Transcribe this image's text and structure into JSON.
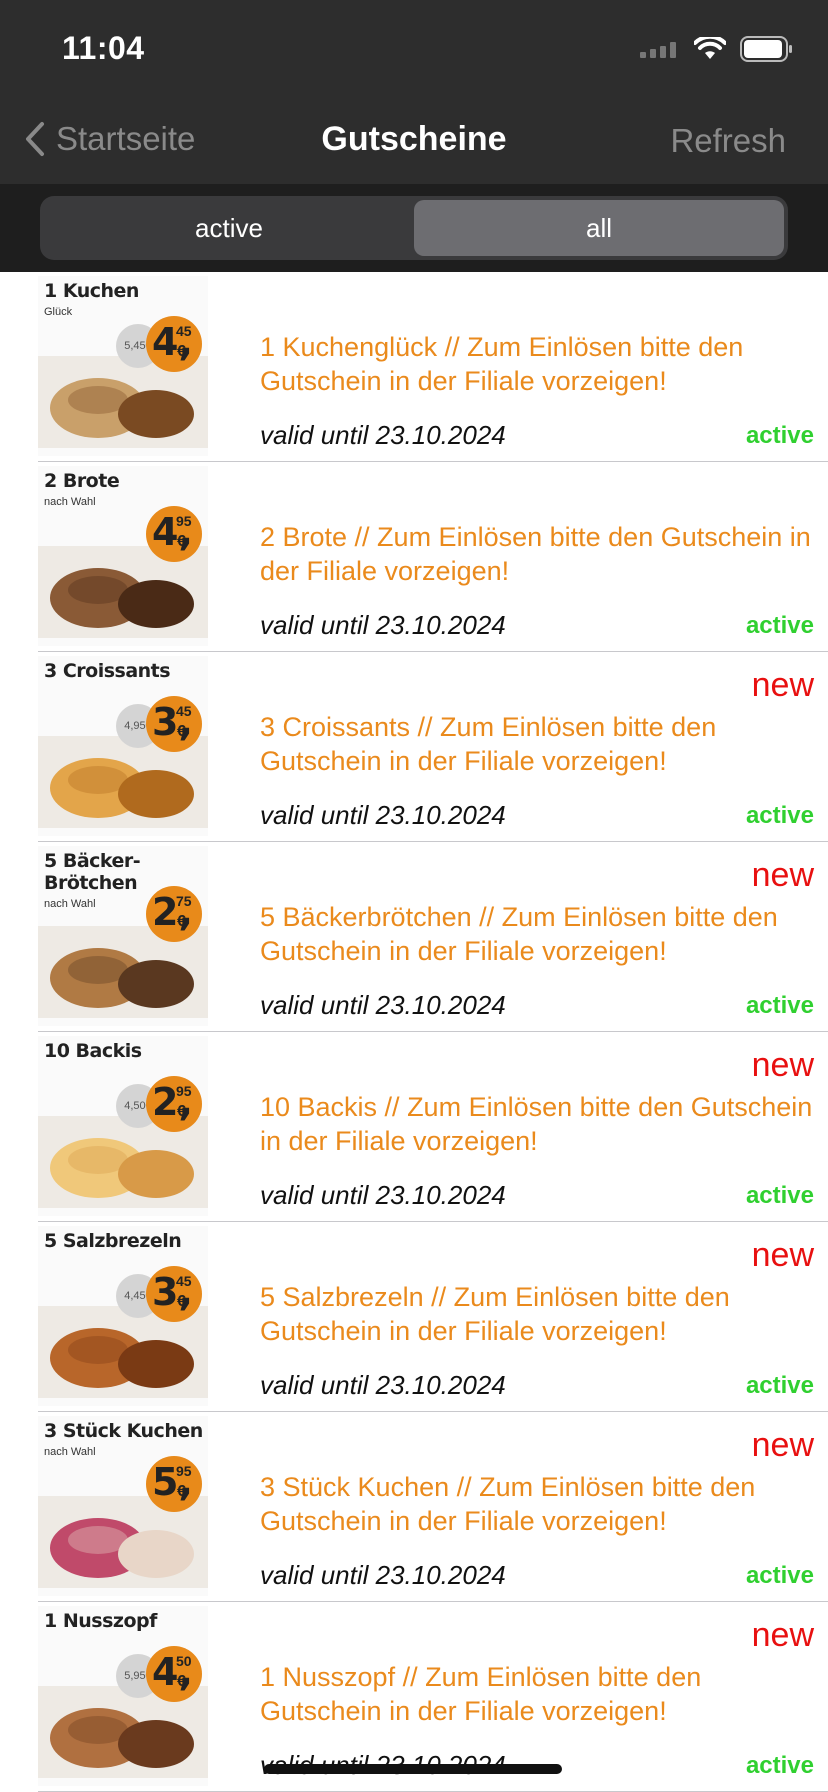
{
  "status_bar": {
    "time": "11:04"
  },
  "nav": {
    "back_label": "Startseite",
    "title": "Gutscheine",
    "refresh_label": "Refresh"
  },
  "segment": {
    "options": [
      "active",
      "all"
    ],
    "selected": "all"
  },
  "colors": {
    "accent_orange": "#ea8a1c",
    "status_green": "#30d030",
    "new_red": "#e81010"
  },
  "coupons": [
    {
      "thumb_title": "1 Kuchen",
      "thumb_sub": "Glück",
      "price_main": "4,",
      "price_cents": "45",
      "old_price": "5,45€",
      "description": "1 Kuchenglück // Zum Einlösen bitte den Gutschein in der Filiale vorzeigen!",
      "valid": "valid until 23.10.2024",
      "status": "active",
      "is_new": false,
      "new_label": ""
    },
    {
      "thumb_title": "2 Brote",
      "thumb_sub": "nach Wahl",
      "price_main": "4,",
      "price_cents": "95",
      "old_price": "",
      "description": "2 Brote // Zum Einlösen bitte den Gutschein in der Filiale vorzeigen!",
      "valid": "valid until 23.10.2024",
      "status": "active",
      "is_new": false,
      "new_label": ""
    },
    {
      "thumb_title": "3 Croissants",
      "thumb_sub": "",
      "price_main": "3,",
      "price_cents": "45",
      "old_price": "4,95€",
      "description": "3 Croissants // Zum Einlösen bitte den Gutschein in der Filiale vorzeigen!",
      "valid": "valid until 23.10.2024",
      "status": "active",
      "is_new": true,
      "new_label": "new"
    },
    {
      "thumb_title": "5 Bäcker-Brötchen",
      "thumb_sub": "nach Wahl",
      "price_main": "2,",
      "price_cents": "75",
      "old_price": "",
      "description": "5 Bäckerbrötchen // Zum Einlösen bitte den Gutschein in der Filiale vorzeigen!",
      "valid": "valid until 23.10.2024",
      "status": "active",
      "is_new": true,
      "new_label": "new"
    },
    {
      "thumb_title": "10 Backis",
      "thumb_sub": "",
      "price_main": "2,",
      "price_cents": "95",
      "old_price": "4,50€",
      "description": "10 Backis // Zum Einlösen bitte den Gutschein in der Filiale vorzeigen!",
      "valid": "valid until 23.10.2024",
      "status": "active",
      "is_new": true,
      "new_label": "new"
    },
    {
      "thumb_title": "5 Salzbrezeln",
      "thumb_sub": "",
      "price_main": "3,",
      "price_cents": "45",
      "old_price": "4,45€",
      "description": "5 Salzbrezeln // Zum Einlösen bitte den Gutschein in der Filiale vorzeigen!",
      "valid": "valid until 23.10.2024",
      "status": "active",
      "is_new": true,
      "new_label": "new"
    },
    {
      "thumb_title": "3 Stück Kuchen",
      "thumb_sub": "nach Wahl",
      "price_main": "5,",
      "price_cents": "95",
      "old_price": "",
      "description": "3 Stück Kuchen // Zum Einlösen bitte den Gutschein in der Filiale vorzeigen!",
      "valid": "valid until 23.10.2024",
      "status": "active",
      "is_new": true,
      "new_label": "new"
    },
    {
      "thumb_title": "1 Nusszopf",
      "thumb_sub": "",
      "price_main": "4,",
      "price_cents": "50",
      "old_price": "5,95€",
      "description": "1 Nusszopf // Zum Einlösen bitte den Gutschein in der Filiale vorzeigen!",
      "valid": "valid until 23.10.2024",
      "status": "active",
      "is_new": true,
      "new_label": "new"
    }
  ]
}
